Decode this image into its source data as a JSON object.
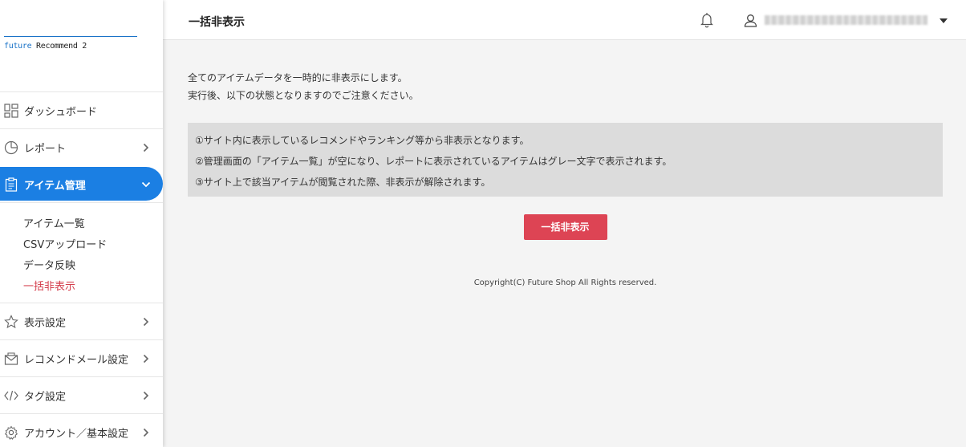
{
  "logo": {
    "accent_text": "future",
    "rest_text": " Recommend 2"
  },
  "header": {
    "title": "一括非表示",
    "user_name": "■■■■■■■■■■■■■■■■■■■■"
  },
  "sidebar": {
    "items": [
      {
        "label": "ダッシュボード",
        "icon": "dashboard-icon"
      },
      {
        "label": "レポート",
        "icon": "pie-chart-icon"
      },
      {
        "label": "アイテム管理",
        "icon": "clipboard-icon"
      },
      {
        "label": "表示設定",
        "icon": "star-icon"
      },
      {
        "label": "レコメンドメール設定",
        "icon": "mail-icon"
      },
      {
        "label": "タグ設定",
        "icon": "code-icon"
      },
      {
        "label": "アカウント／基本設定",
        "icon": "gear-icon"
      }
    ],
    "sub_items": [
      {
        "label": "アイテム一覧"
      },
      {
        "label": "CSVアップロード"
      },
      {
        "label": "データ反映"
      },
      {
        "label": "一括非表示"
      }
    ]
  },
  "main": {
    "intro_line1": "全てのアイテムデータを一時的に非表示にします。",
    "intro_line2": "実行後、以下の状態となりますのでご注意ください。",
    "notice_lines": [
      "①サイト内に表示しているレコメンドやランキング等から非表示となります。",
      "②管理画面の「アイテム一覧」が空になり、レポートに表示されているアイテムはグレー文字で表示されます。",
      "③サイト上で該当アイテムが閲覧された際、非表示が解除されます。"
    ],
    "button_label": "一括非表示",
    "footer": "Copyright(C) Future Shop All Rights reserved."
  },
  "colors": {
    "accent": "#1b7fe3",
    "danger": "#dd4454",
    "current_sub": "#d43c4b"
  }
}
